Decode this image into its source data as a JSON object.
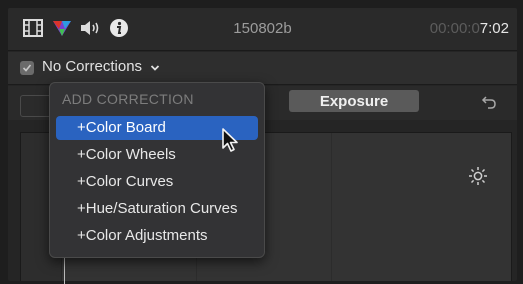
{
  "header": {
    "clip_name": "150802b",
    "timecode_dim": "00:00:0",
    "timecode_bright": "7:02",
    "icons": [
      "filmstrip-icon",
      "color-triangle-icon",
      "speaker-icon",
      "info-icon"
    ]
  },
  "corrections": {
    "label": "No Corrections",
    "checked": true
  },
  "tabs": {
    "active": "Exposure"
  },
  "menu": {
    "header": "ADD CORRECTION",
    "items": [
      {
        "label": "+Color Board",
        "selected": true
      },
      {
        "label": "+Color Wheels",
        "selected": false
      },
      {
        "label": "+Color Curves",
        "selected": false
      },
      {
        "label": "+Hue/Saturation Curves",
        "selected": false
      },
      {
        "label": "+Color Adjustments",
        "selected": false
      }
    ]
  },
  "colors": {
    "selection": "#2a63c0",
    "panel": "#333335",
    "active_tab": "#5a5a5a"
  }
}
